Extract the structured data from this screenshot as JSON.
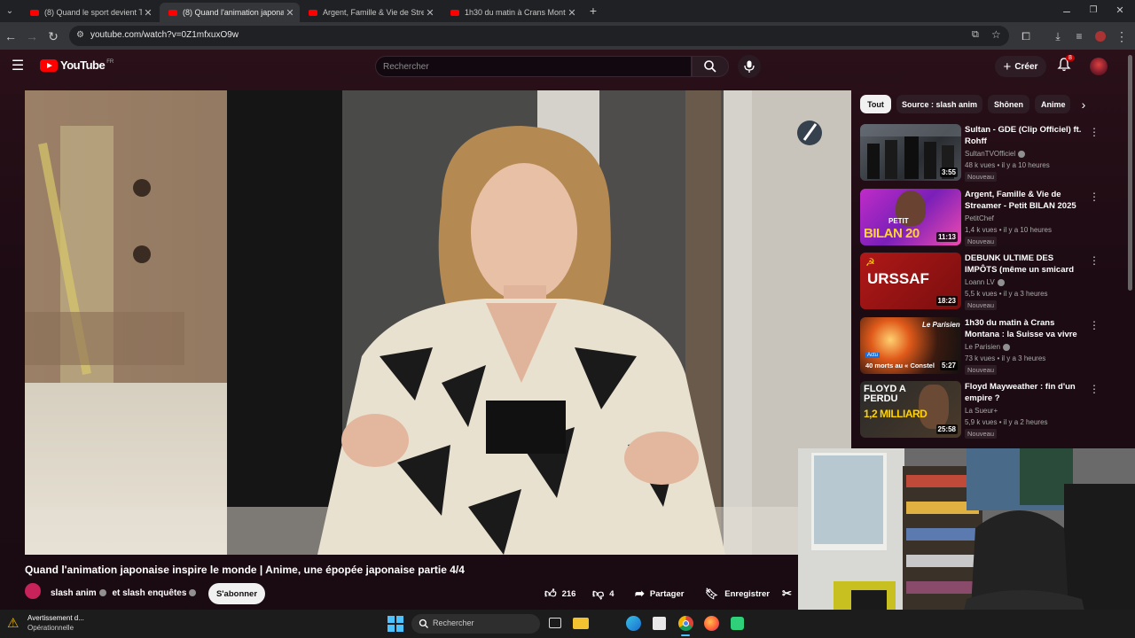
{
  "browser": {
    "tabs": [
      {
        "label": "(8) Quand le sport devient TOX",
        "active": false
      },
      {
        "label": "(8) Quand l'animation japonaise",
        "active": true
      },
      {
        "label": "Argent, Famille & Vie de Strean",
        "active": false
      },
      {
        "label": "1h30 du matin à Crans Montana",
        "active": false
      }
    ],
    "url": "youtube.com/watch?v=0Z1mfxuxO9w"
  },
  "youtube": {
    "logo_text": "YouTube",
    "region": "FR",
    "search_placeholder": "Rechercher",
    "create_label": "Créer",
    "notif_count": "8"
  },
  "chips": [
    "Tout",
    "Source : slash anim",
    "Shōnen",
    "Anime"
  ],
  "recommendations": [
    {
      "title": "Sultan - GDE (Clip Officiel) ft. Rohff",
      "channel": "SultanTVOfficiel",
      "meta": "48 k vues • il y a 10 heures",
      "badge": "Nouveau",
      "duration": "3:55",
      "verified": true,
      "thumb_overlay": ""
    },
    {
      "title": "Argent, Famille & Vie de Streamer - Petit BILAN 2025",
      "channel": "PetitChef",
      "meta": "1,4 k vues • il y a 10 heures",
      "badge": "Nouveau",
      "duration": "11:13",
      "verified": false,
      "thumb_overlay": "BILAN 20",
      "thumb_overlay_small": "PETIT"
    },
    {
      "title": "DEBUNK ULTIME DES IMPÔTS (même un smicard n'est pas ...",
      "channel": "Loann LV",
      "meta": "5,5 k vues • il y a 3 heures",
      "badge": "Nouveau",
      "duration": "18:23",
      "verified": true,
      "thumb_overlay": "URSSAF"
    },
    {
      "title": "1h30 du matin à Crans Montana : la Suisse va vivre la pire ...",
      "channel": "Le Parisien",
      "meta": "73 k vues • il y a 3 heures",
      "badge": "Nouveau",
      "duration": "5:27",
      "verified": true,
      "thumb_overlay": "40 morts au « Constel",
      "thumb_overlay_small": "Le Parisien",
      "thumb_tag": "Actu"
    },
    {
      "title": "Floyd Mayweather : fin d'un empire ?",
      "channel": "La Sueur+",
      "meta": "5,9 k vues • il y a 2 heures",
      "badge": "Nouveau",
      "duration": "25:58",
      "verified": false,
      "thumb_overlay": "FLOYD A PERDU",
      "thumb_overlay_small": "1,2 MILLIARD"
    }
  ],
  "video": {
    "title": "Quand l'animation japonaise inspire le monde | Anime, une épopée japonaise partie 4/4",
    "channel_line": "slash anim",
    "channel_and": "et slash enquêtes",
    "subscribe_label": "S'abonner",
    "likes": "216",
    "dislikes": "4",
    "share_label": "Partager",
    "save_label": "Enregistrer"
  },
  "taskbar": {
    "warning_title": "Avertissement d...",
    "warning_sub": "Opérationnelle",
    "search_label": "Rechercher"
  },
  "colors": {
    "yt_red": "#ff0000",
    "page_bg": "#1d0b13",
    "chip_active": "#f1f1f1"
  }
}
